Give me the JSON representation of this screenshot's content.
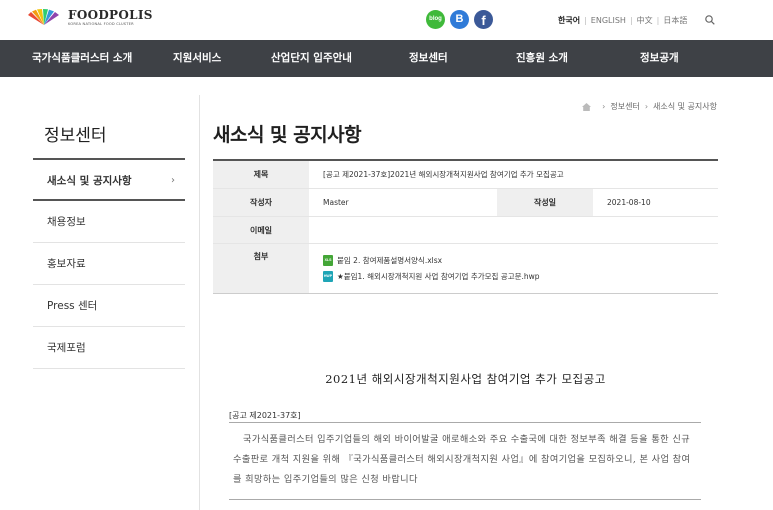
{
  "brand": {
    "name": "FOODPOLIS",
    "subtitle": "KOREA NATIONAL FOOD CLUSTER",
    "colors": [
      "#e94b35",
      "#f39c12",
      "#f1c40f",
      "#2ecc71",
      "#3498db",
      "#8e44ad"
    ]
  },
  "social": {
    "blog": "blog",
    "band": "B",
    "facebook": "f"
  },
  "languages": [
    {
      "label": "한국어",
      "active": true
    },
    {
      "label": "ENGLISH",
      "active": false
    },
    {
      "label": "中文",
      "active": false
    },
    {
      "label": "日本語",
      "active": false
    }
  ],
  "nav": [
    {
      "label": "국가식품클러스터 소개"
    },
    {
      "label": "지원서비스"
    },
    {
      "label": "산업단지 입주안내"
    },
    {
      "label": "정보센터"
    },
    {
      "label": "진흥원 소개"
    },
    {
      "label": "정보공개"
    }
  ],
  "breadcrumb": {
    "items": [
      "정보센터",
      "새소식 및 공지사항"
    ]
  },
  "sidebar": {
    "title": "정보센터",
    "items": [
      {
        "label": "새소식 및 공지사항",
        "active": true
      },
      {
        "label": "채용정보",
        "active": false
      },
      {
        "label": "홍보자료",
        "active": false
      },
      {
        "label": "Press 센터",
        "active": false
      },
      {
        "label": "국제포럼",
        "active": false
      }
    ],
    "chevron": "›"
  },
  "page": {
    "title": "새소식 및 공지사항"
  },
  "post": {
    "subject_label": "제목",
    "subject": "[공고 제2021-37호]2021년 해외시장개척지원사업 참여기업 추가 모집공고",
    "writer_label": "작성자",
    "writer": "Master",
    "date_label": "작성일",
    "date": "2021-08-10",
    "email_label": "이메일",
    "email": "",
    "attach_label": "첨부",
    "attachments": [
      {
        "type": "XLS",
        "name": "붙임 2. 참여제품설명서양식.xlsx"
      },
      {
        "type": "HWP",
        "name": "★붙임1. 해외시장개척지원 사업 참여기업 추가모집 공고문.hwp"
      }
    ]
  },
  "notice": {
    "title": "2021년 해외시장개척지원사업 참여기업 추가 모집공고",
    "number": "[공고 제2021-37호]",
    "body": "국가식품클러스터 입주기업들의 해외 바이어발굴 애로해소와 주요 수출국에 대한 정보부족 해결 등을 통한 신규 수출판로 개척 지원을 위해 『국가식품클러스터 해외시장개척지원 사업』에 참여기업을 모집하오니, 본 사업 참여를 희망하는 입주기업들의 많은 신청 바랍니다"
  }
}
